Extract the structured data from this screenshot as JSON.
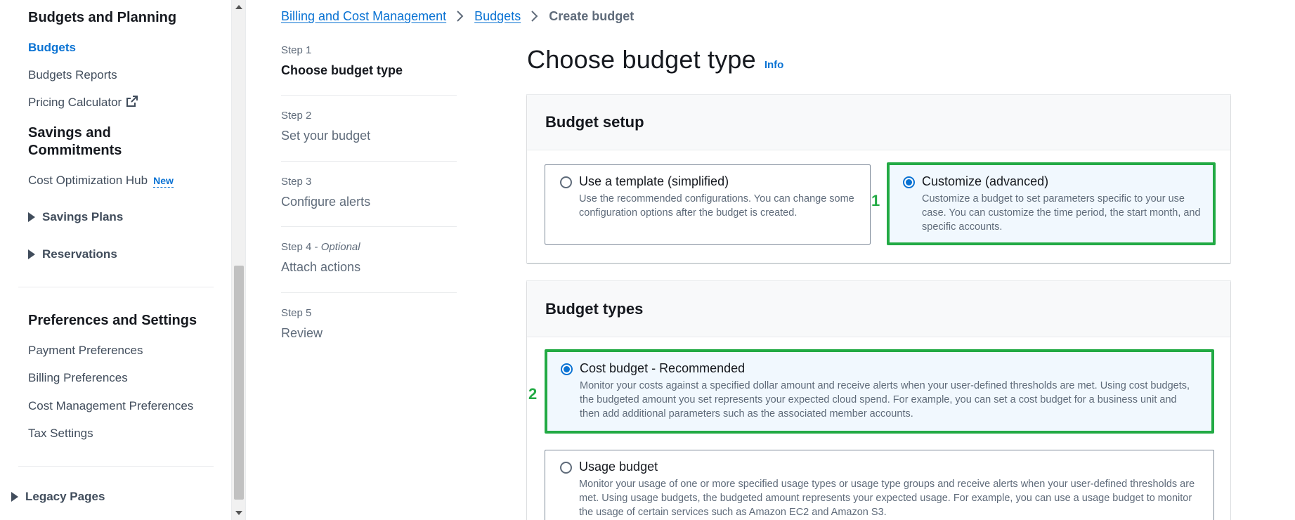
{
  "sidebar": {
    "section_budgets": "Budgets and Planning",
    "budgets": "Budgets",
    "budgets_reports": "Budgets Reports",
    "pricing_calculator": "Pricing Calculator",
    "section_savings_line1": "Savings and",
    "section_savings_line2": "Commitments",
    "cost_optimization_hub": "Cost Optimization Hub",
    "new_badge": "New",
    "savings_plans": "Savings Plans",
    "reservations": "Reservations",
    "section_preferences": "Preferences and Settings",
    "payment_preferences": "Payment Preferences",
    "billing_preferences": "Billing Preferences",
    "cost_management_preferences": "Cost Management Preferences",
    "tax_settings": "Tax Settings",
    "legacy_pages": "Legacy Pages"
  },
  "breadcrumb": {
    "items": [
      "Billing and Cost Management",
      "Budgets"
    ],
    "current": "Create budget"
  },
  "steps": [
    {
      "num": "Step 1",
      "label": "Choose budget type"
    },
    {
      "num": "Step 2",
      "label": "Set your budget"
    },
    {
      "num": "Step 3",
      "label": "Configure alerts"
    },
    {
      "num": "Step 4",
      "optional": "Optional",
      "label": "Attach actions"
    },
    {
      "num": "Step 5",
      "label": "Review"
    }
  ],
  "page": {
    "title": "Choose budget type",
    "info": "Info"
  },
  "budget_setup": {
    "heading": "Budget setup",
    "template_title": "Use a template (simplified)",
    "template_desc": "Use the recommended configurations. You can change some configuration options after the budget is created.",
    "custom_title": "Customize (advanced)",
    "custom_desc": "Customize a budget to set parameters specific to your use case. You can customize the time period, the start month, and specific accounts.",
    "marker": "1"
  },
  "budget_types": {
    "heading": "Budget types",
    "cost_title": "Cost budget - Recommended",
    "cost_desc": "Monitor your costs against a specified dollar amount and receive alerts when your user-defined thresholds are met. Using cost budgets, the budgeted amount you set represents your expected cloud spend. For example, you can set a cost budget for a business unit and then add additional parameters such as the associated member accounts.",
    "usage_title": "Usage budget",
    "usage_desc": "Monitor your usage of one or more specified usage types or usage type groups and receive alerts when your user-defined thresholds are met. Using usage budgets, the budgeted amount represents your expected usage. For example, you can use a usage budget to monitor the usage of certain services such as Amazon EC2 and Amazon S3.",
    "marker": "2"
  },
  "colors": {
    "link": "#0972d3",
    "highlight": "#22aa44",
    "selected_bg": "#f1f8fe"
  }
}
